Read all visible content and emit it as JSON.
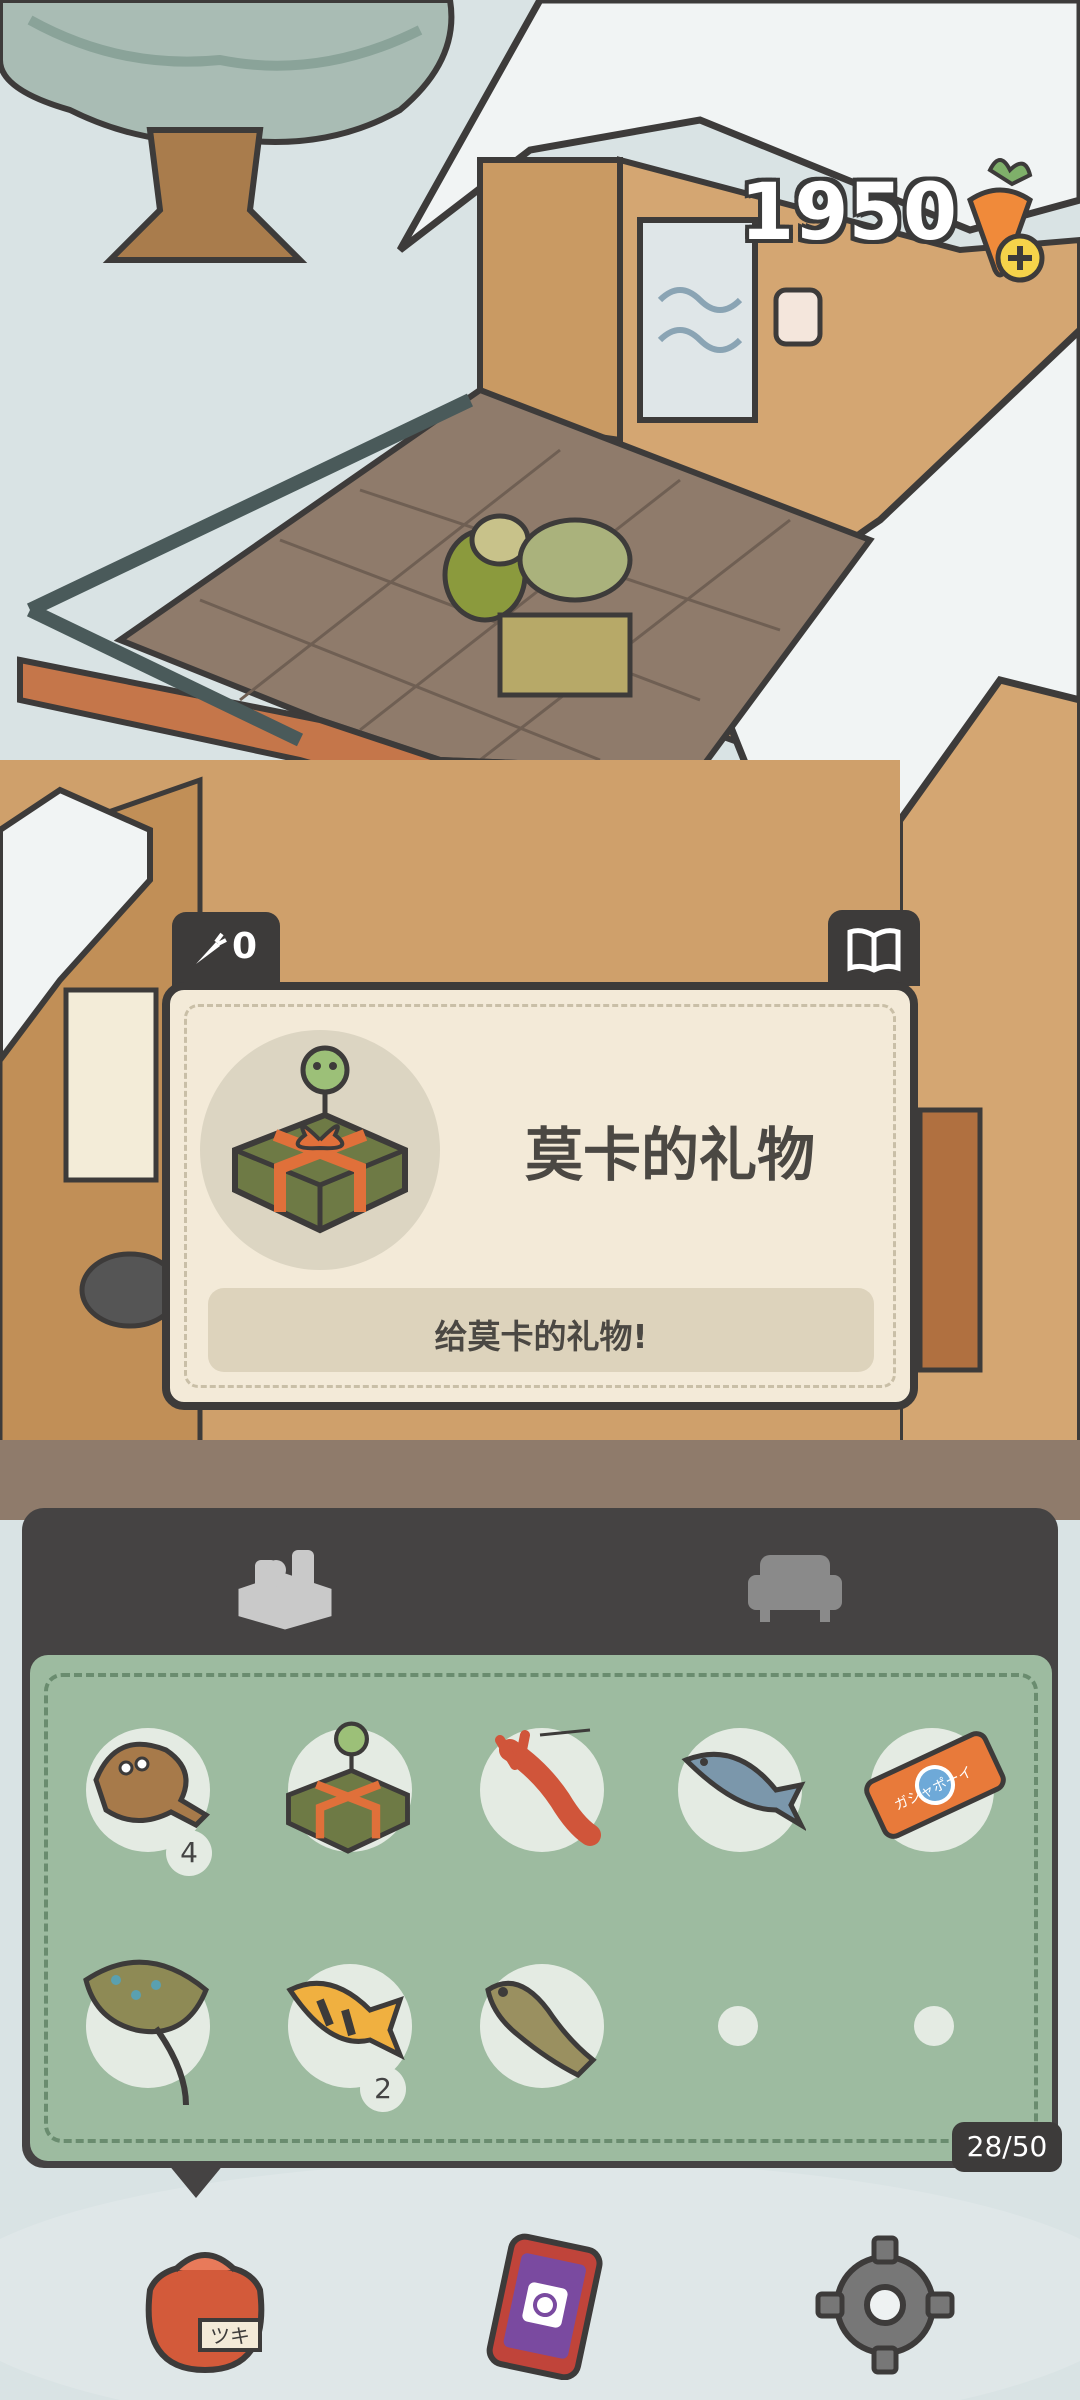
{
  "currency": {
    "carrots": "1950",
    "icon": "carrot-add-icon"
  },
  "item_detail": {
    "carrot_tag_value": "0",
    "title": "莫卡的礼物",
    "description": "给莫卡的礼物!",
    "book_icon": "book-icon"
  },
  "inventory": {
    "tabs": [
      {
        "name": "items",
        "icon": "basket-icon"
      },
      {
        "name": "furniture",
        "icon": "sofa-icon"
      }
    ],
    "capacity": "28/50",
    "slots": [
      {
        "item": "flatfish",
        "count": "4"
      },
      {
        "item": "gift-box",
        "count": ""
      },
      {
        "item": "lobster",
        "count": ""
      },
      {
        "item": "mackerel",
        "count": ""
      },
      {
        "item": "gacha-ticket",
        "count": "",
        "label": "ガシャポーイ"
      },
      {
        "item": "stingray",
        "count": ""
      },
      {
        "item": "goldfish",
        "count": "2"
      },
      {
        "item": "goby",
        "count": ""
      },
      {
        "item": "empty",
        "count": ""
      },
      {
        "item": "empty",
        "count": ""
      }
    ]
  },
  "bottom_nav": [
    {
      "name": "bag",
      "icon": "bag-icon",
      "label": "ツキ"
    },
    {
      "name": "phone",
      "icon": "phone-icon"
    },
    {
      "name": "settings",
      "icon": "gear-icon"
    }
  ],
  "colors": {
    "dark": "#3d3b3a",
    "card": "#f3ead8",
    "panel_green": "#9dbba0",
    "snow": "#eef2f2"
  }
}
